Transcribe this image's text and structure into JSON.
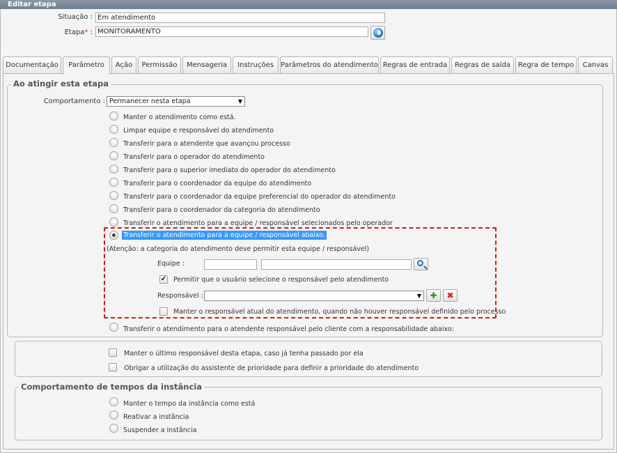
{
  "window": {
    "title": "Editar etapa"
  },
  "header": {
    "situacao_label": "Situação :",
    "situacao_value": "Em atendimento",
    "etapa_label": "Etapa",
    "etapa_required": "*",
    "etapa_colon": " :",
    "etapa_value": "MONITORAMENTO"
  },
  "tabs": [
    {
      "label": "Documentação"
    },
    {
      "label": "Parâmetro",
      "active": true
    },
    {
      "label": "Ação"
    },
    {
      "label": "Permissão"
    },
    {
      "label": "Mensageria"
    },
    {
      "label": "Instruções"
    },
    {
      "label": "Parâmetros do atendimento"
    },
    {
      "label": "Regras de entrada"
    },
    {
      "label": "Regras de saída"
    },
    {
      "label": "Regra de tempo"
    },
    {
      "label": "Canvas"
    }
  ],
  "section1": {
    "legend": "Ao atingir esta etapa",
    "comportamento_label": "Comportamento :",
    "comportamento_value": "Permanecer nesta etapa",
    "options": [
      "Manter o atendimento como está.",
      "Limpar equipe e responsável do atendimento",
      "Transferir para o atendente que avançou processo",
      "Transferir para o operador do atendimento",
      "Transferir para o superior imediato do operador do atendimento",
      "Transferir para o coordenador da equipe do atendimento",
      "Transferir para o coordenador da equipe preferencial do operador do atendimento",
      "Transferir para o coordenador da categoria do atendimento",
      "Transferir o atendimento para a equipe / responsável selecionados pelo operador",
      "Transferir o atendimento para a equipe / responsável abaixo."
    ],
    "selected_index": 9,
    "note": "(Atenção: a categoria do atendimento deve permitir esta equipe / responsável)",
    "equipe_label": "Equipe :",
    "equipe_code": "",
    "equipe_name": "",
    "permitir_label": "Permitir que o usuário selecione o responsável pelo atendimento",
    "permitir_checked": true,
    "responsavel_label": "Responsável :",
    "responsavel_value": "",
    "manter_label": "Manter o responsável atual do atendimento, quando não houver responsável definido pelo processo",
    "manter_checked": false,
    "last_option": "Transferir o atendimento para o atendente responsável pelo cliente com a responsabilidade abaixo:"
  },
  "section2": {
    "check1_label": "Manter o último responsável desta etapa, caso já tenha passado por ela",
    "check2_label": "Obrigar a utilização do assistente de prioridade para definir a prioridade do atendimento"
  },
  "section3": {
    "legend": "Comportamento de tempos da instância",
    "options": [
      "Manter o tempo da instância como está",
      "Reativar a instância",
      "Suspender a instância"
    ]
  },
  "icons": {
    "dropdown_arrow": "▼",
    "check_mark": "✔",
    "add": "✚",
    "remove": "✖"
  },
  "colors": {
    "selected_highlight": "#3399ff",
    "dashed_border": "#d01a1a",
    "add_icon": "#2e8b2e",
    "remove_icon": "#d22020"
  }
}
